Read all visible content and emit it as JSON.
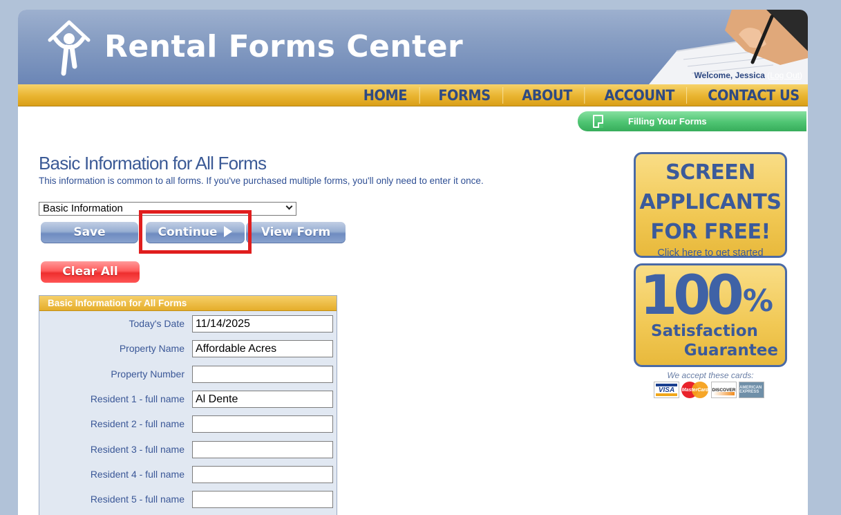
{
  "header": {
    "brand": "Rental Forms Center",
    "welcome": "Welcome, Jessica",
    "logout_label": "Log Out"
  },
  "nav": {
    "items": [
      "HOME",
      "FORMS",
      "ABOUT",
      "ACCOUNT",
      "CONTACT US"
    ]
  },
  "filling": {
    "label": "Filling Your Forms"
  },
  "main": {
    "title": "Basic Information for All Forms",
    "subtitle": "This information is common to all forms. If you've purchased multiple forms, you'll only need to enter it once.",
    "select_value": "Basic Information",
    "buttons": {
      "save": "Save",
      "continue": "Continue",
      "view_form": "View Form",
      "clear_all": "Clear All"
    }
  },
  "form": {
    "heading": "Basic Information for All Forms",
    "fields": [
      {
        "label": "Today's Date",
        "value": "11/14/2025"
      },
      {
        "label": "Property Name",
        "value": "Affordable Acres"
      },
      {
        "label": "Property Number",
        "value": ""
      },
      {
        "label": "Resident 1 - full name",
        "value": "Al Dente"
      },
      {
        "label": "Resident 2 - full name",
        "value": ""
      },
      {
        "label": "Resident 3 - full name",
        "value": ""
      },
      {
        "label": "Resident 4 - full name",
        "value": ""
      },
      {
        "label": "Resident 5 - full name",
        "value": ""
      }
    ]
  },
  "ads": {
    "screen": {
      "line1": "SCREEN",
      "line2": "APPLICANTS",
      "line3": "FOR FREE!",
      "cta": "Click here to get started"
    },
    "guarantee": {
      "pct": "100",
      "sign": "%",
      "line1": "Satisfaction",
      "line2": "Guarantee"
    },
    "accept_text": "We accept these cards:",
    "cards": [
      "VISA",
      "MasterCard",
      "DISCOVER",
      "AMERICAN EXPRESS"
    ]
  },
  "colors": {
    "accent_blue": "#3b5a96",
    "nav_gold": "#e9b430",
    "pill_green": "#4ec472",
    "highlight_red": "#e01e1e"
  }
}
